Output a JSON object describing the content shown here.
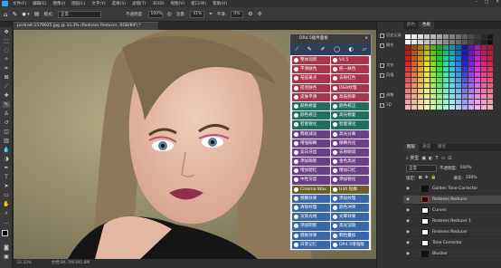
{
  "app": {
    "menus": [
      "文件(F)",
      "编辑(E)",
      "图像(I)",
      "图层(L)",
      "文字(Y)",
      "选择(S)",
      "滤镜(T)",
      "3D(D)",
      "视图(V)",
      "窗口(W)",
      "帮助(H)"
    ]
  },
  "options": {
    "mode_label": "模式:",
    "mode_value": "正常",
    "opacity_label": "不透明度:",
    "opacity_value": "100%",
    "flow_label": "流量:",
    "flow_value": "41%",
    "smooth_label": "平滑:",
    "smooth_value": "0%"
  },
  "document": {
    "tab_title": "portrait-1579025.jpg @ 33.3% (Redness Reducer, RGB/8#) *",
    "zoom": "33.33%",
    "doc_size": "文档:84.7M/395.8M"
  },
  "plugin": {
    "title": "DR4.5插件面板",
    "close": "×",
    "buttons": [
      {
        "label": "整体润饰",
        "style": "c-red"
      },
      {
        "label": "V4.5",
        "style": "c-red"
      },
      {
        "label": "平滑肤色",
        "style": "c-red"
      },
      {
        "label": "统一肤色",
        "style": "c-red"
      },
      {
        "label": "祛痘斑点",
        "style": "c-red"
      },
      {
        "label": "去除红色",
        "style": "c-red"
      },
      {
        "label": "提亮肤色",
        "style": "c-red"
      },
      {
        "label": "D&B纹理",
        "style": "c-red"
      },
      {
        "label": "皮肤平滑",
        "style": "c-red"
      },
      {
        "label": "高低频率",
        "style": "c-red"
      },
      {
        "label": "颜色修复",
        "style": "c-green"
      },
      {
        "label": "颜色校正",
        "style": "c-green"
      },
      {
        "label": "颜色修正",
        "style": "c-green"
      },
      {
        "label": "高光修复",
        "style": "c-green"
      },
      {
        "label": "智能锐化",
        "style": "c-green"
      },
      {
        "label": "智能液化",
        "style": "c-green"
      },
      {
        "label": "两极减淡",
        "style": "c-purple"
      },
      {
        "label": "高光分离",
        "style": "c-purple"
      },
      {
        "label": "增强眼睛",
        "style": "c-purple"
      },
      {
        "label": "眼睛亮化",
        "style": "c-purple"
      },
      {
        "label": "美白牙齿",
        "style": "c-purple"
      },
      {
        "label": "去除眼袋",
        "style": "c-purple"
      },
      {
        "label": "添加眼影",
        "style": "c-purple"
      },
      {
        "label": "金色高光",
        "style": "c-purple"
      },
      {
        "label": "增加腮红",
        "style": "c-purple"
      },
      {
        "label": "增加口红",
        "style": "c-purple"
      },
      {
        "label": "中性灰度",
        "style": "c-purple"
      },
      {
        "label": "添加锐化",
        "style": "c-purple"
      },
      {
        "label": "Cinema Wax",
        "style": "c-gold"
      },
      {
        "label": "H3ñ 轮廓",
        "style": "c-gold"
      },
      {
        "label": "模糊效果",
        "style": "c-blue"
      },
      {
        "label": "添加纹理",
        "style": "c-blue"
      },
      {
        "label": "清除纹理",
        "style": "c-blue"
      },
      {
        "label": "颜色冲突",
        "style": "c-blue"
      },
      {
        "label": "渲染光线",
        "style": "c-blue"
      },
      {
        "label": "光晕效果",
        "style": "c-blue"
      },
      {
        "label": "添加阴影",
        "style": "c-blue"
      },
      {
        "label": "高光渲染",
        "style": "c-blue"
      },
      {
        "label": "模板效果",
        "style": "c-blue"
      },
      {
        "label": "颗粒叠加",
        "style": "c-blue"
      },
      {
        "label": "日景记忆",
        "style": "c-blue"
      },
      {
        "label": "DR4.5增强版",
        "style": "c-blue"
      }
    ]
  },
  "dock": {
    "items": [
      "历史记录",
      "属性",
      "字符",
      "段落",
      "调整",
      "3D"
    ]
  },
  "panels": {
    "top_tabs": [
      "颜色",
      "色板"
    ],
    "layer_tabs": [
      "图层",
      "通道",
      "路径"
    ],
    "blend_mode": "正常",
    "opacity_label": "不透明度:",
    "opacity_value": "100%",
    "fill_label": "填充:",
    "fill_value": "100%",
    "layers": [
      {
        "name": "Golden Tone Corrector",
        "thumb": "dark"
      },
      {
        "name": "Redness Reducer",
        "thumb": "red",
        "selected": true
      },
      {
        "name": "Curves",
        "thumb": "white"
      },
      {
        "name": "Redness Reducer 1",
        "thumb": "white"
      },
      {
        "name": "Redness Reducer",
        "thumb": "white"
      },
      {
        "name": "Tone Corrector",
        "thumb": "white"
      },
      {
        "name": "Blusher",
        "thumb": "dark"
      }
    ]
  },
  "colors": {
    "accent": "#31a8ff",
    "plugin_header": "#2d3f59",
    "red_btn": "#a8354b",
    "green_btn": "#1f6e60",
    "purple_btn": "#6b3f86",
    "gold_btn": "#6e5e2a",
    "blue_btn": "#3a67a8"
  }
}
